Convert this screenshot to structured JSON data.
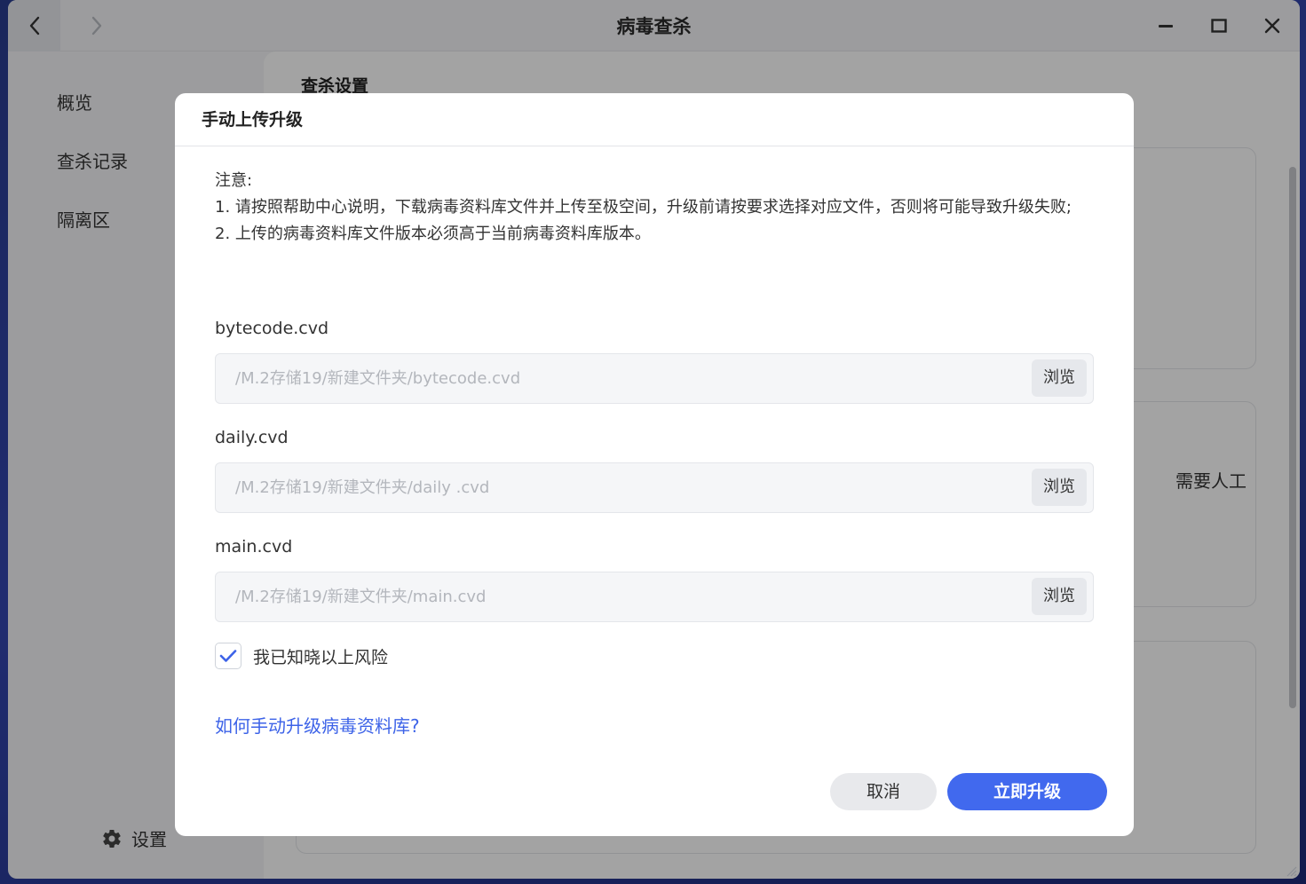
{
  "window": {
    "title": "病毒查杀"
  },
  "sidebar": {
    "items": [
      {
        "label": "概览"
      },
      {
        "label": "查杀记录"
      },
      {
        "label": "隔离区"
      }
    ],
    "settings_label": "设置"
  },
  "content": {
    "title": "查杀设置",
    "card_partial_text": "需要人工"
  },
  "dialog": {
    "title": "手动上传升级",
    "notice": {
      "heading": "注意:",
      "line1": "1. 请按照帮助中心说明，下载病毒资料库文件并上传至极空间，升级前请按要求选择对应文件，否则将可能导致升级失败;",
      "line2": "2. 上传的病毒资料库文件版本必须高于当前病毒资料库版本。"
    },
    "files": [
      {
        "label": "bytecode.cvd",
        "path": "/M.2存储19/新建文件夹/bytecode.cvd",
        "browse": "浏览"
      },
      {
        "label": "daily.cvd",
        "path": "/M.2存储19/新建文件夹/daily .cvd",
        "browse": "浏览"
      },
      {
        "label": "main.cvd",
        "path": "/M.2存储19/新建文件夹/main.cvd",
        "browse": "浏览"
      }
    ],
    "risk_ack": {
      "label": "我已知晓以上风险",
      "checked": true
    },
    "help_link": "如何手动升级病毒资料库?",
    "cancel_label": "取消",
    "confirm_label": "立即升级"
  },
  "colors": {
    "accent": "#4169ee",
    "link": "#3d63e8"
  }
}
